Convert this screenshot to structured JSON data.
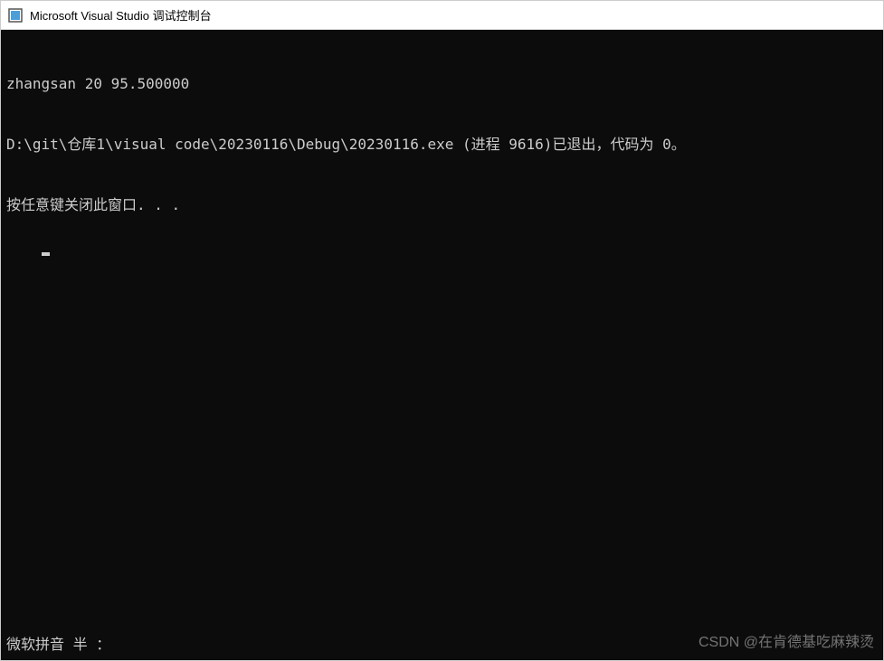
{
  "titlebar": {
    "title": "Microsoft Visual Studio 调试控制台"
  },
  "console": {
    "lines": [
      "zhangsan 20 95.500000",
      "D:\\git\\仓库1\\visual code\\20230116\\Debug\\20230116.exe (进程 9616)已退出，代码为 0。",
      "按任意键关闭此窗口. . ."
    ]
  },
  "ime": {
    "status": "微软拼音 半 ："
  },
  "watermark": {
    "text": "CSDN @在肯德基吃麻辣烫"
  }
}
